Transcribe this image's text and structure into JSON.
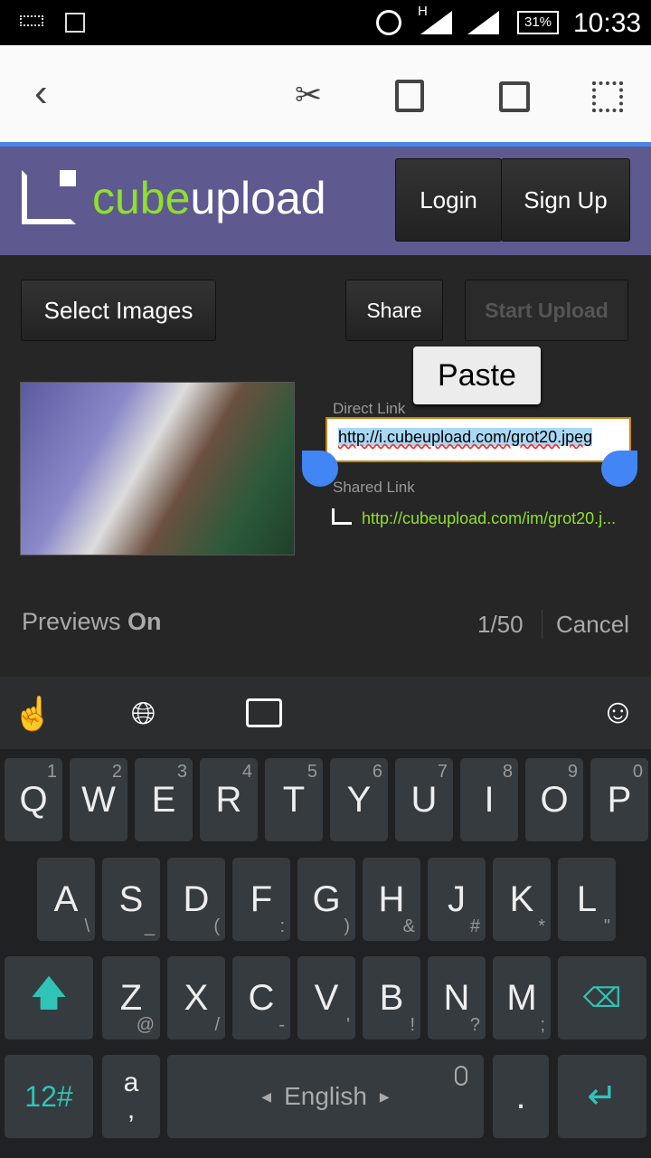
{
  "status": {
    "battery": "31%",
    "time": "10:33",
    "network": "H"
  },
  "actionbar": {
    "icons": [
      "back-icon",
      "cut-icon",
      "paste-icon",
      "copy-icon",
      "select-all-icon"
    ]
  },
  "header": {
    "logo_a": "cube",
    "logo_b": "upload",
    "login": "Login",
    "signup": "Sign Up"
  },
  "main": {
    "select_images": "Select Images",
    "share": "Share",
    "start_upload": "Start Upload",
    "paste": "Paste",
    "direct_label": "Direct Link",
    "direct_value": "http://i.cubeupload.com/grot20.jpeg",
    "shared_label": "Shared Link",
    "shared_value": "http://cubeupload.com/im/grot20.j...",
    "previews": "Previews",
    "previews_state": "On",
    "count": "1/50",
    "cancel": "Cancel"
  },
  "keyboard": {
    "row1": [
      [
        "Q",
        "1"
      ],
      [
        "W",
        "2"
      ],
      [
        "E",
        "3"
      ],
      [
        "R",
        "4"
      ],
      [
        "T",
        "5"
      ],
      [
        "Y",
        "6"
      ],
      [
        "U",
        "7"
      ],
      [
        "I",
        "8"
      ],
      [
        "O",
        "9"
      ],
      [
        "P",
        "0"
      ]
    ],
    "row2": [
      [
        "A",
        "\\"
      ],
      [
        "S",
        "_"
      ],
      [
        "D",
        "("
      ],
      [
        "F",
        ":"
      ],
      [
        "G",
        ")"
      ],
      [
        "H",
        "&"
      ],
      [
        "J",
        "#"
      ],
      [
        "K",
        "*"
      ],
      [
        "L",
        "\""
      ]
    ],
    "row3": [
      [
        "Z",
        "@"
      ],
      [
        "X",
        "/"
      ],
      [
        "C",
        "-"
      ],
      [
        "V",
        "'"
      ],
      [
        "B",
        "!"
      ],
      [
        "N",
        "?"
      ],
      [
        "M",
        ";"
      ]
    ],
    "symbols": "12#",
    "alt_a": "a",
    "alt_comma": ",",
    "space": "English",
    "period": ".",
    "accent": "#2ec4b6"
  }
}
